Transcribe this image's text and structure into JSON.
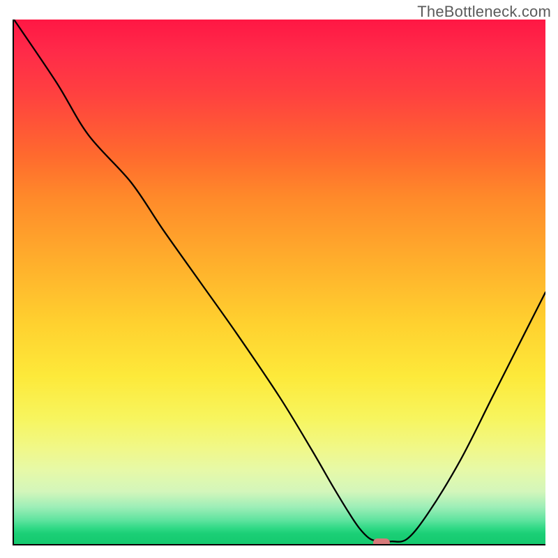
{
  "watermark": "TheBottleneck.com",
  "chart_data": {
    "type": "line",
    "title": "",
    "xlabel": "",
    "ylabel": "",
    "xlim": [
      0,
      100
    ],
    "ylim": [
      0,
      100
    ],
    "grid": false,
    "series": [
      {
        "name": "curve",
        "x": [
          0,
          8,
          14,
          22,
          28,
          35,
          42,
          50,
          56,
          60,
          63,
          65,
          67,
          69,
          71,
          74,
          78,
          84,
          90,
          96,
          100
        ],
        "values": [
          100,
          88,
          78,
          69,
          60,
          50,
          40,
          28,
          18,
          11,
          6,
          3,
          1,
          0.5,
          0.5,
          1,
          6,
          16,
          28,
          40,
          48
        ]
      }
    ],
    "marker": {
      "x": 69,
      "y": 0.5,
      "color": "#d67a7a"
    },
    "background_gradient": {
      "stops": [
        {
          "pos": 0,
          "color": "#ff1744"
        },
        {
          "pos": 50,
          "color": "#ffc12e"
        },
        {
          "pos": 78,
          "color": "#f5f66a"
        },
        {
          "pos": 100,
          "color": "#14c96e"
        }
      ]
    }
  }
}
